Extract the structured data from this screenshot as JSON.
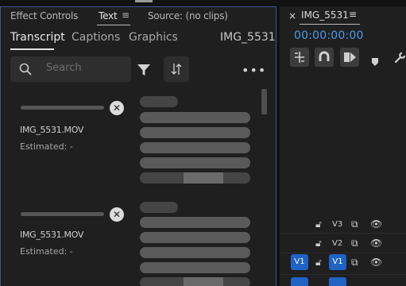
{
  "text_panel": {
    "tabs": [
      {
        "label": "Effect Controls",
        "active": false
      },
      {
        "label": "Text",
        "active": true
      },
      {
        "label": "Source: (no clips)",
        "active": false
      }
    ],
    "menu_icon": "hamburger-menu-icon",
    "subtabs": [
      {
        "label": "Transcript",
        "active": true
      },
      {
        "label": "Captions",
        "active": false
      },
      {
        "label": "Graphics",
        "active": false
      }
    ],
    "sequence_name": "IMG_5531",
    "search": {
      "placeholder": "Search",
      "icon": "search-icon"
    },
    "filter_icon": "filter-icon",
    "sync_icon": "sync-icon",
    "more_icon": "more-icon",
    "transcript_items": [
      {
        "clip": "IMG_5531.MOV",
        "status": "Estimated: -"
      },
      {
        "clip": "IMG_5531.MOV",
        "status": "Estimated: -"
      }
    ]
  },
  "timeline": {
    "tab_label": "IMG_5531",
    "close_glyph": "×",
    "menu_glyph": "≡",
    "timecode": "00:00:00:00",
    "tools": [
      "insert-icon",
      "magnet-icon",
      "linked-selection-icon",
      "marker-icon",
      "wrench-icon"
    ],
    "tracks": [
      {
        "source": "",
        "name": "V3",
        "source_active": false
      },
      {
        "source": "",
        "name": "V2",
        "source_active": false
      },
      {
        "source": "V1",
        "name": "V1",
        "source_active": true
      }
    ],
    "accent_color": "#1f63c4",
    "timecode_color": "#4c9cf0"
  }
}
